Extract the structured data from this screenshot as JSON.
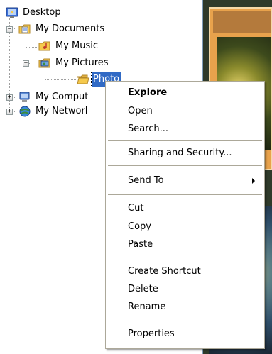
{
  "tree": {
    "items": [
      {
        "label": "Desktop",
        "icon": "desktop-icon"
      },
      {
        "label": "My Documents",
        "icon": "folder-documents-icon",
        "expander": "−"
      },
      {
        "label": "My Music",
        "icon": "folder-music-icon"
      },
      {
        "label": "My Pictures",
        "icon": "folder-pictures-icon",
        "expander": "−"
      },
      {
        "label": "Photo",
        "icon": "folder-open-icon",
        "selected": true
      },
      {
        "label": "My Comput",
        "icon": "my-computer-icon",
        "expander": "+"
      },
      {
        "label": "My Networl",
        "icon": "my-network-icon",
        "expander": "+"
      }
    ]
  },
  "context_menu": {
    "explore": "Explore",
    "open": "Open",
    "search": "Search...",
    "sharing": "Sharing and Security...",
    "send_to": "Send To",
    "cut": "Cut",
    "copy": "Copy",
    "paste": "Paste",
    "create_shortcut": "Create Shortcut",
    "delete": "Delete",
    "rename": "Rename",
    "properties": "Properties"
  },
  "colors": {
    "selection": "#316ac5",
    "menu_border": "#aca899",
    "folder_yellow": "#f5c94c"
  }
}
